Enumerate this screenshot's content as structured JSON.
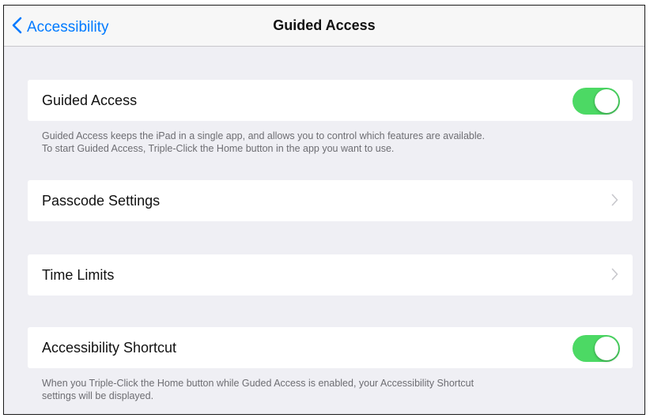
{
  "nav": {
    "back_label": "Accessibility",
    "title": "Guided Access"
  },
  "sections": {
    "guided_access": {
      "label": "Guided Access",
      "toggle_on": true,
      "footer_line1": "Guided Access keeps the iPad in a single app, and allows you to control which features are available.",
      "footer_line2": "To start Guided Access, Triple-Click the Home button in the app you want to use."
    },
    "passcode_settings": {
      "label": "Passcode Settings"
    },
    "time_limits": {
      "label": "Time Limits"
    },
    "accessibility_shortcut": {
      "label": "Accessibility Shortcut",
      "toggle_on": true,
      "footer_line1": "When you Triple-Click the Home button while Guded Access is enabled, your Accessibility Shortcut",
      "footer_line2": "settings will be displayed."
    }
  },
  "colors": {
    "accent": "#007aff",
    "toggle_on": "#4cd964",
    "background": "#efeff4"
  },
  "icons": {
    "back": "chevron-left-icon",
    "disclosure": "chevron-right-icon"
  }
}
